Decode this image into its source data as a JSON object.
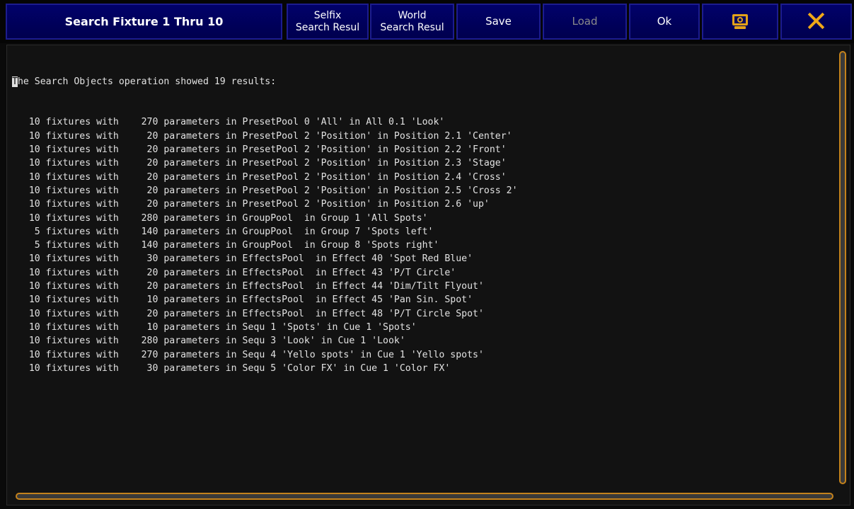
{
  "toolbar": {
    "title": "Search Fixture 1 Thru 10",
    "selfix_line1": "Selfix",
    "selfix_line2": "Search Resul",
    "world_line1": "World",
    "world_line2": "Search Resul",
    "save_label": "Save",
    "load_label": "Load",
    "ok_label": "Ok",
    "screen_icon": "monitor-icon",
    "close_icon": "close-icon"
  },
  "colors": {
    "button_bg": "#00005a",
    "accent": "#f0a818",
    "text": "#e2e2e2",
    "disabled_text": "#8a8a8a"
  },
  "output": {
    "header_first": "T",
    "header_rest": "he Search Objects operation showed 19 results:",
    "lines": [
      "   10 fixtures with    270 parameters in PresetPool 0 'All' in All 0.1 'Look'",
      "   10 fixtures with     20 parameters in PresetPool 2 'Position' in Position 2.1 'Center'",
      "   10 fixtures with     20 parameters in PresetPool 2 'Position' in Position 2.2 'Front'",
      "   10 fixtures with     20 parameters in PresetPool 2 'Position' in Position 2.3 'Stage'",
      "   10 fixtures with     20 parameters in PresetPool 2 'Position' in Position 2.4 'Cross'",
      "   10 fixtures with     20 parameters in PresetPool 2 'Position' in Position 2.5 'Cross 2'",
      "   10 fixtures with     20 parameters in PresetPool 2 'Position' in Position 2.6 'up'",
      "   10 fixtures with    280 parameters in GroupPool  in Group 1 'All Spots'",
      "    5 fixtures with    140 parameters in GroupPool  in Group 7 'Spots left'",
      "    5 fixtures with    140 parameters in GroupPool  in Group 8 'Spots right'",
      "   10 fixtures with     30 parameters in EffectsPool  in Effect 40 'Spot Red Blue'",
      "   10 fixtures with     20 parameters in EffectsPool  in Effect 43 'P/T Circle'",
      "   10 fixtures with     20 parameters in EffectsPool  in Effect 44 'Dim/Tilt Flyout'",
      "   10 fixtures with     10 parameters in EffectsPool  in Effect 45 'Pan Sin. Spot'",
      "   10 fixtures with     20 parameters in EffectsPool  in Effect 48 'P/T Circle Spot'",
      "   10 fixtures with     10 parameters in Sequ 1 'Spots' in Cue 1 'Spots'",
      "   10 fixtures with    280 parameters in Sequ 3 'Look' in Cue 1 'Look'",
      "   10 fixtures with    270 parameters in Sequ 4 'Yello spots' in Cue 1 'Yello spots'",
      "   10 fixtures with     30 parameters in Sequ 5 'Color FX' in Cue 1 'Color FX'"
    ]
  }
}
